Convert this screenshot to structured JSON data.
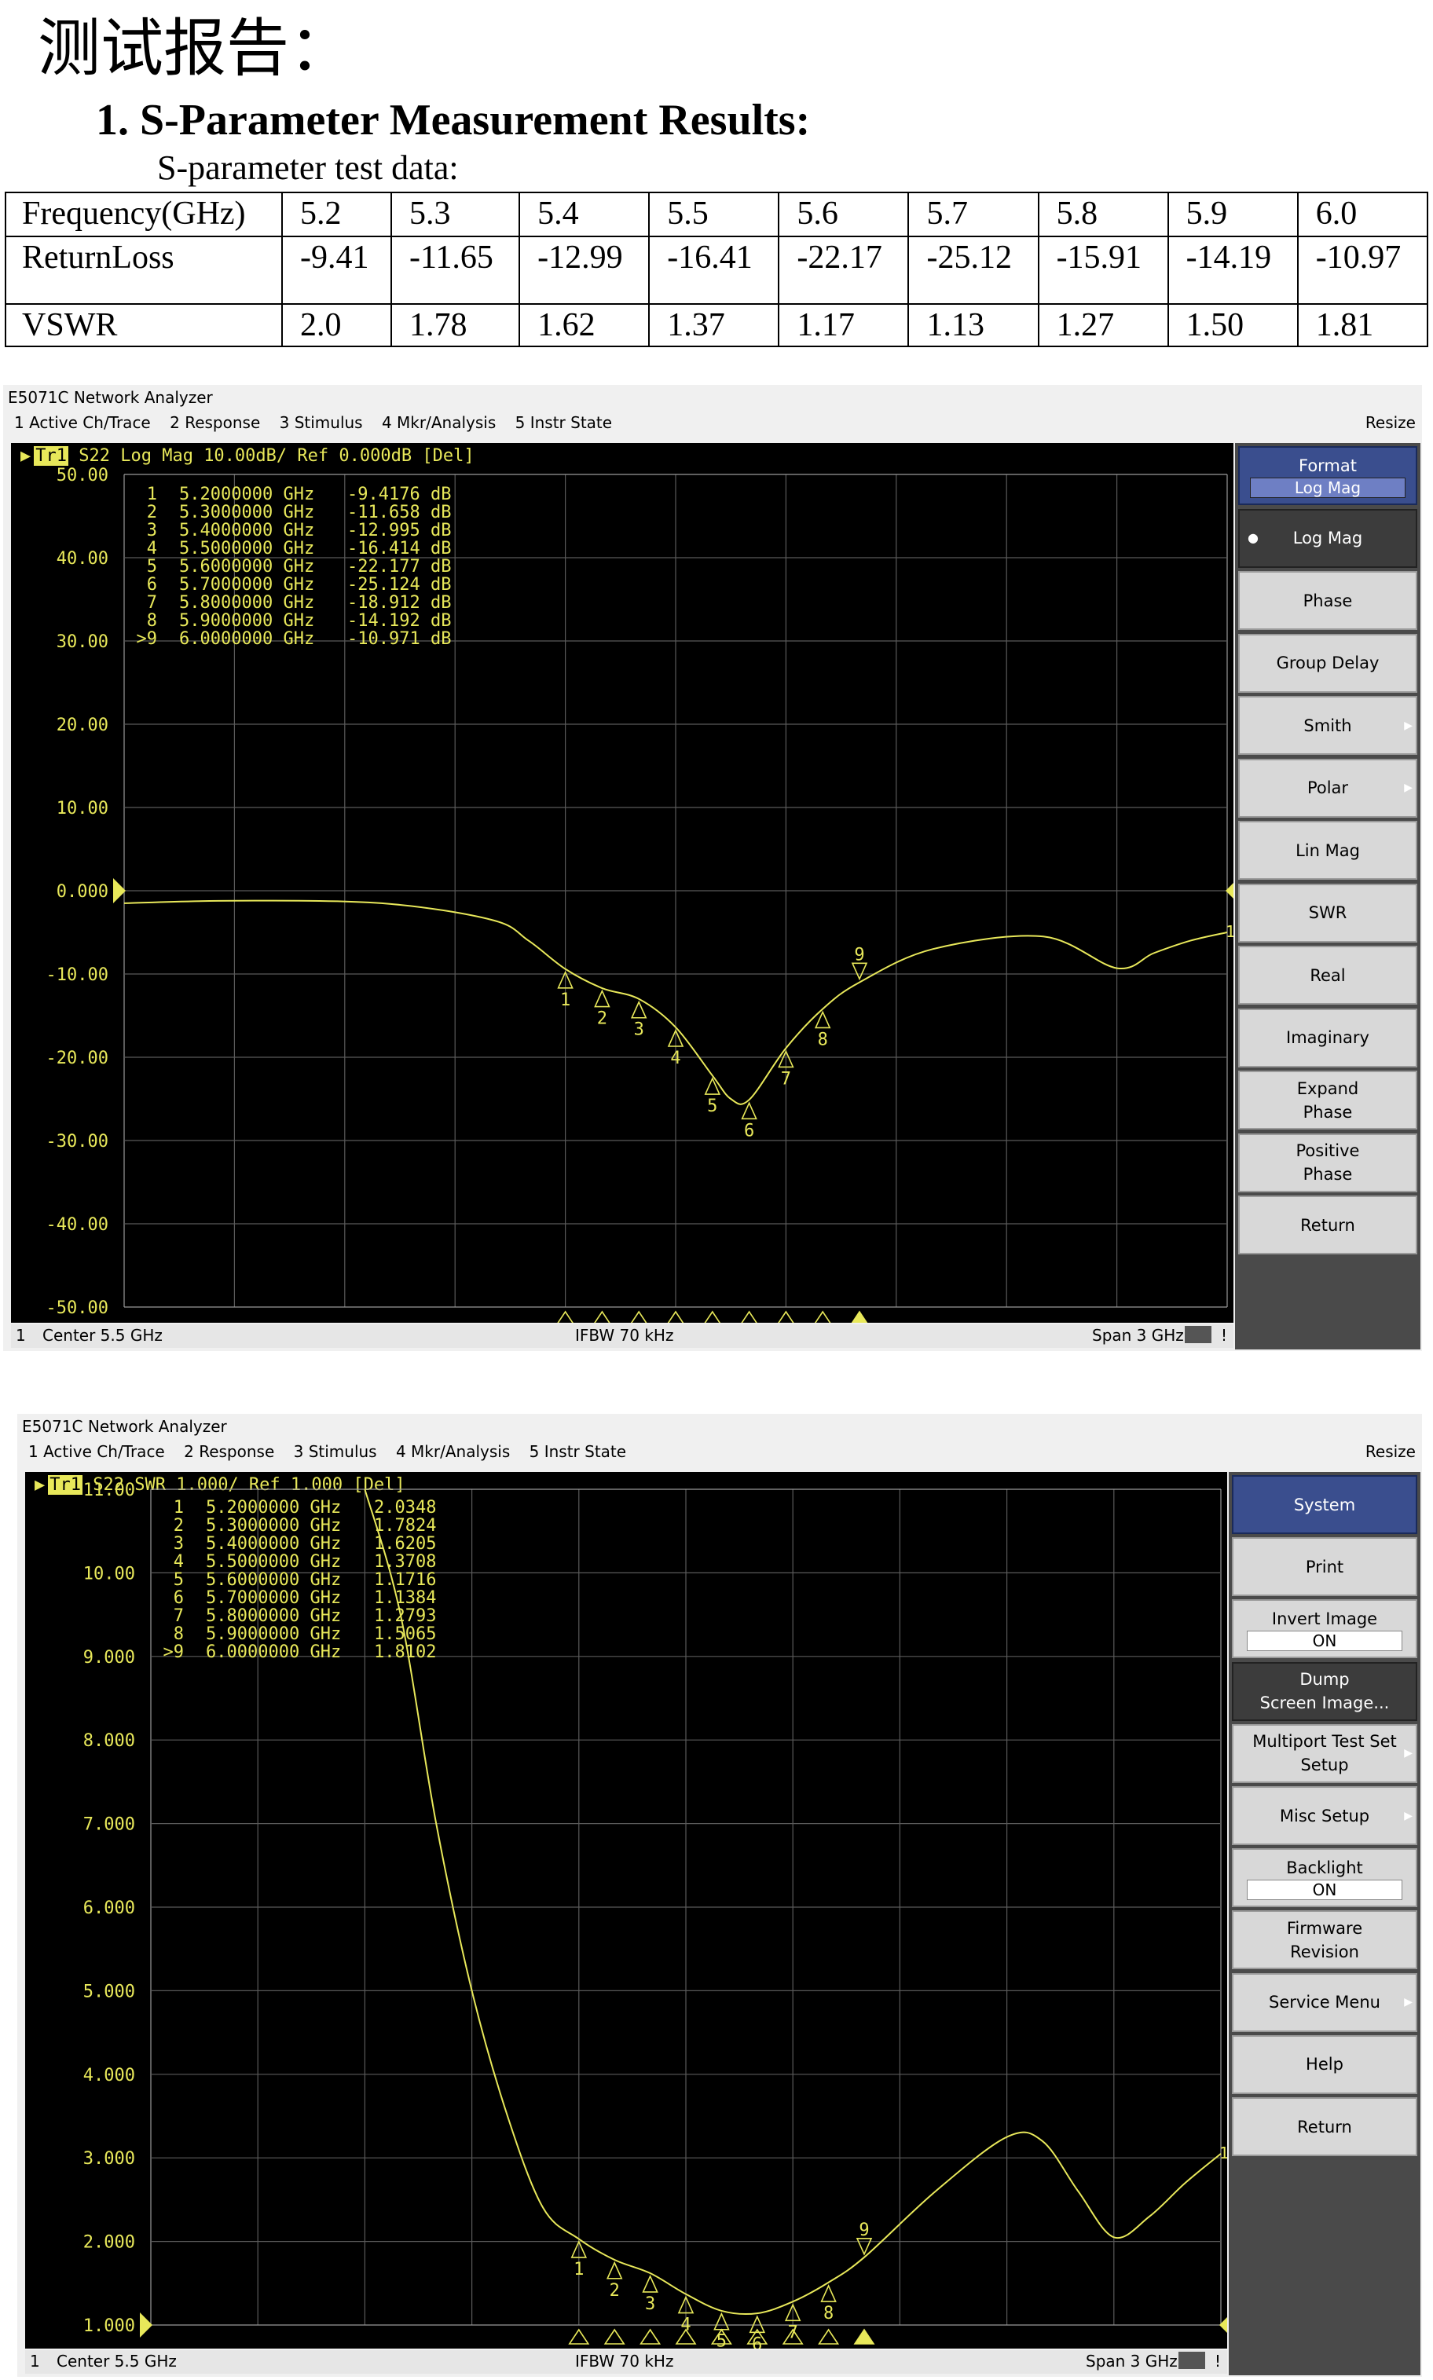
{
  "document": {
    "title": "测试报告：",
    "section": "1.  S-Parameter Measurement Results:",
    "subtitle": "S-parameter test data:"
  },
  "table": {
    "rows": [
      {
        "label": "Frequency(GHz)",
        "values": [
          "5.2",
          "5.3",
          "5.4",
          "5.5",
          "5.6",
          "5.7",
          "5.8",
          "5.9",
          "6.0"
        ]
      },
      {
        "label": "ReturnLoss",
        "values": [
          "-9.41",
          "-11.65",
          "-12.99",
          "-16.41",
          "-22.17",
          "-25.12",
          "-15.91",
          "-14.19",
          "-10.97"
        ]
      },
      {
        "label": "VSWR",
        "values": [
          "2.0",
          "1.78",
          "1.62",
          "1.37",
          "1.17",
          "1.13",
          "1.27",
          "1.50",
          "1.81"
        ]
      }
    ]
  },
  "analyzers": [
    {
      "title": "E5071C Network Analyzer",
      "menu": [
        "1 Active Ch/Trace",
        "2 Response",
        "3 Stimulus",
        "4 Mkr/Analysis",
        "5 Instr State"
      ],
      "resize": "Resize",
      "trace_label": "Tr1",
      "trace_header": "S22 Log Mag 10.00dB/ Ref 0.000dB [Del]",
      "status": {
        "channel": "1",
        "center": "Center 5.5 GHz",
        "ifbw": "IFBW 70 kHz",
        "span": "Span 3 GHz",
        "flag": "!"
      },
      "marker_list": [
        {
          "id": "1",
          "freq": "5.2000000 GHz",
          "val": "-9.4176 dB"
        },
        {
          "id": "2",
          "freq": "5.3000000 GHz",
          "val": "-11.658 dB"
        },
        {
          "id": "3",
          "freq": "5.4000000 GHz",
          "val": "-12.995 dB"
        },
        {
          "id": "4",
          "freq": "5.5000000 GHz",
          "val": "-16.414 dB"
        },
        {
          "id": "5",
          "freq": "5.6000000 GHz",
          "val": "-22.177 dB"
        },
        {
          "id": "6",
          "freq": "5.7000000 GHz",
          "val": "-25.124 dB"
        },
        {
          "id": "7",
          "freq": "5.8000000 GHz",
          "val": "-18.912 dB"
        },
        {
          "id": "8",
          "freq": "5.9000000 GHz",
          "val": "-14.192 dB"
        },
        {
          "id": ">9",
          "freq": "6.0000000 GHz",
          "val": "-10.971 dB"
        }
      ],
      "softkeys": [
        {
          "label": "Format",
          "sub": "Log Mag",
          "kind": "head"
        },
        {
          "label": "Log Mag",
          "kind": "active"
        },
        {
          "label": "Phase"
        },
        {
          "label": "Group Delay"
        },
        {
          "label": "Smith",
          "arrow": true
        },
        {
          "label": "Polar",
          "arrow": true
        },
        {
          "label": "Lin Mag"
        },
        {
          "label": "SWR"
        },
        {
          "label": "Real"
        },
        {
          "label": "Imaginary"
        },
        {
          "label": "Expand\nPhase"
        },
        {
          "label": "Positive\nPhase"
        },
        {
          "label": "Return"
        }
      ]
    },
    {
      "title": "E5071C Network Analyzer",
      "menu": [
        "1 Active Ch/Trace",
        "2 Response",
        "3 Stimulus",
        "4 Mkr/Analysis",
        "5 Instr State"
      ],
      "resize": "Resize",
      "trace_label": "Tr1",
      "trace_header": "S22 SWR 1.000/ Ref 1.000 [Del]",
      "status": {
        "channel": "1",
        "center": "Center 5.5 GHz",
        "ifbw": "IFBW 70 kHz",
        "span": "Span 3 GHz",
        "flag": "!"
      },
      "marker_list": [
        {
          "id": "1",
          "freq": "5.2000000 GHz",
          "val": "2.0348"
        },
        {
          "id": "2",
          "freq": "5.3000000 GHz",
          "val": "1.7824"
        },
        {
          "id": "3",
          "freq": "5.4000000 GHz",
          "val": "1.6205"
        },
        {
          "id": "4",
          "freq": "5.5000000 GHz",
          "val": "1.3708"
        },
        {
          "id": "5",
          "freq": "5.6000000 GHz",
          "val": "1.1716"
        },
        {
          "id": "6",
          "freq": "5.7000000 GHz",
          "val": "1.1384"
        },
        {
          "id": "7",
          "freq": "5.8000000 GHz",
          "val": "1.2793"
        },
        {
          "id": "8",
          "freq": "5.9000000 GHz",
          "val": "1.5065"
        },
        {
          "id": ">9",
          "freq": "6.0000000 GHz",
          "val": "1.8102"
        }
      ],
      "softkeys": [
        {
          "label": "System",
          "kind": "head"
        },
        {
          "label": "Print"
        },
        {
          "label": "Invert Image",
          "sub": "ON"
        },
        {
          "label": "Dump\nScreen Image...",
          "kind": "active"
        },
        {
          "label": "Multiport Test Set\nSetup",
          "arrow": true
        },
        {
          "label": "Misc Setup",
          "arrow": true
        },
        {
          "label": "Backlight",
          "sub": "ON"
        },
        {
          "label": "Firmware\nRevision"
        },
        {
          "label": "Service Menu",
          "arrow": true
        },
        {
          "label": "Help"
        },
        {
          "label": "Return"
        }
      ]
    }
  ],
  "chart_data": [
    {
      "type": "line",
      "title": "",
      "xlabel": "",
      "ylabel": "",
      "xlim": [
        4.0,
        7.0
      ],
      "ylim": [
        -50,
        50
      ],
      "y_ticks": [
        "50.00",
        "40.00",
        "30.00",
        "20.00",
        "10.00",
        "0.000",
        "-10.00",
        "-20.00",
        "-30.00",
        "-40.00",
        "-50.00"
      ],
      "reference_value": 0,
      "grid": true,
      "line_color": "#e8e85a",
      "background": "#000000",
      "series": [
        {
          "x": [
            4.0,
            4.3,
            4.7,
            5.0,
            5.1,
            5.2,
            5.3,
            5.4,
            5.5,
            5.6,
            5.65,
            5.7,
            5.8,
            5.9,
            6.0,
            6.2,
            6.5,
            6.7,
            6.8,
            6.9,
            7.0
          ],
          "y": [
            -1.5,
            -1.2,
            -1.5,
            -3.5,
            -6.0,
            -9.4,
            -11.7,
            -13.0,
            -16.4,
            -22.2,
            -25.0,
            -25.1,
            -18.9,
            -14.2,
            -11.0,
            -7.0,
            -5.5,
            -9.3,
            -7.5,
            -6.0,
            -5.0
          ]
        }
      ],
      "markers": [
        {
          "label": "1",
          "x": 5.2,
          "y": -9.4176
        },
        {
          "label": "2",
          "x": 5.3,
          "y": -11.658
        },
        {
          "label": "3",
          "x": 5.4,
          "y": -12.995
        },
        {
          "label": "4",
          "x": 5.5,
          "y": -16.414
        },
        {
          "label": "5",
          "x": 5.6,
          "y": -22.177
        },
        {
          "label": "6",
          "x": 5.7,
          "y": -25.124
        },
        {
          "label": "7",
          "x": 5.8,
          "y": -18.912
        },
        {
          "label": "8",
          "x": 5.9,
          "y": -14.192
        },
        {
          "label": "9",
          "x": 6.0,
          "y": -10.971
        }
      ]
    },
    {
      "type": "line",
      "title": "",
      "xlabel": "",
      "ylabel": "",
      "xlim": [
        4.0,
        7.0
      ],
      "ylim": [
        1,
        11
      ],
      "y_ticks": [
        "11.00",
        "10.00",
        "9.000",
        "8.000",
        "7.000",
        "6.000",
        "5.000",
        "4.000",
        "3.000",
        "2.000",
        "1.000"
      ],
      "reference_value": 1,
      "grid": true,
      "line_color": "#e8e85a",
      "background": "#000000",
      "series": [
        {
          "x": [
            4.6,
            4.7,
            4.8,
            4.9,
            5.0,
            5.1,
            5.2,
            5.3,
            5.4,
            5.5,
            5.6,
            5.7,
            5.8,
            5.9,
            6.0,
            6.2,
            6.4,
            6.5,
            6.6,
            6.7,
            6.8,
            6.9,
            7.0
          ],
          "y": [
            11.0,
            9.5,
            7.0,
            5.0,
            3.5,
            2.4,
            2.03,
            1.78,
            1.62,
            1.37,
            1.17,
            1.14,
            1.28,
            1.51,
            1.81,
            2.6,
            3.25,
            3.2,
            2.6,
            2.05,
            2.3,
            2.7,
            3.05
          ]
        }
      ],
      "markers": [
        {
          "label": "1",
          "x": 5.2,
          "y": 2.0348
        },
        {
          "label": "2",
          "x": 5.3,
          "y": 1.7824
        },
        {
          "label": "3",
          "x": 5.4,
          "y": 1.6205
        },
        {
          "label": "4",
          "x": 5.5,
          "y": 1.3708
        },
        {
          "label": "5",
          "x": 5.6,
          "y": 1.1716
        },
        {
          "label": "6",
          "x": 5.7,
          "y": 1.1384
        },
        {
          "label": "7",
          "x": 5.8,
          "y": 1.2793
        },
        {
          "label": "8",
          "x": 5.9,
          "y": 1.5065
        },
        {
          "label": "9",
          "x": 6.0,
          "y": 1.8102
        }
      ]
    }
  ]
}
